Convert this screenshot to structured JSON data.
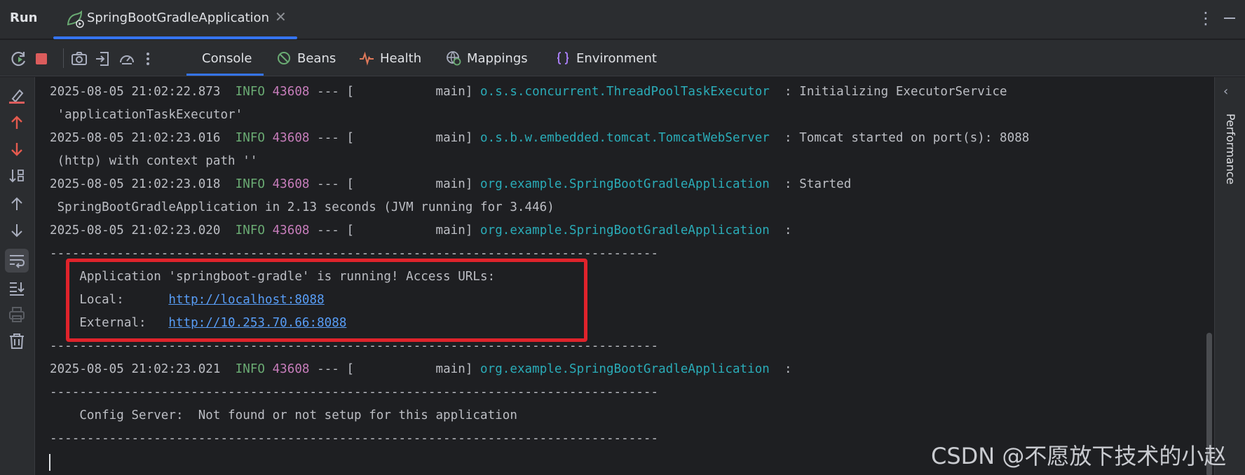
{
  "header": {
    "title": "Run",
    "run_tab_label": "SpringBootGradleApplication"
  },
  "toolbar": {
    "tabs": [
      {
        "label": "Console",
        "icon": "console",
        "active": true
      },
      {
        "label": "Beans",
        "icon": "beans-icon"
      },
      {
        "label": "Health",
        "icon": "health-icon"
      },
      {
        "label": "Mappings",
        "icon": "mappings-icon"
      },
      {
        "label": "Environment",
        "icon": "environment-icon"
      }
    ]
  },
  "console": {
    "lines": [
      {
        "ts": "2025-08-05 21:02:22.873",
        "level": "INFO",
        "pid": "43608",
        "sep": "--- [",
        "thread": "           main]",
        "logger": "o.s.s.concurrent.ThreadPoolTaskExecutor",
        "msg": "  : Initializing ExecutorService"
      },
      {
        "text": " 'applicationTaskExecutor'"
      },
      {
        "ts": "2025-08-05 21:02:23.016",
        "level": "INFO",
        "pid": "43608",
        "sep": "--- [",
        "thread": "           main]",
        "logger": "o.s.b.w.embedded.tomcat.TomcatWebServer",
        "msg": "  : Tomcat started on port(s): 8088"
      },
      {
        "text": " (http) with context path ''"
      },
      {
        "ts": "2025-08-05 21:02:23.018",
        "level": "INFO",
        "pid": "43608",
        "sep": "--- [",
        "thread": "           main]",
        "logger": "org.example.SpringBootGradleApplication",
        "msg": "  : Started"
      },
      {
        "text": " SpringBootGradleApplication in 2.13 seconds (JVM running for 3.446)"
      },
      {
        "ts": "2025-08-05 21:02:23.020",
        "level": "INFO",
        "pid": "43608",
        "sep": "--- [",
        "thread": "           main]",
        "logger": "org.example.SpringBootGradleApplication",
        "msg": "  :"
      },
      {
        "text": "----------------------------------------------------------------------------------"
      },
      {
        "text": "    Application 'springboot-gradle' is running! Access URLs:"
      },
      {
        "prefix": "    Local:      ",
        "url": "http://localhost:8088"
      },
      {
        "prefix": "    External:   ",
        "url": "http://10.253.70.66:8088"
      },
      {
        "text": "----------------------------------------------------------------------------------"
      },
      {
        "ts": "2025-08-05 21:02:23.021",
        "level": "INFO",
        "pid": "43608",
        "sep": "--- [",
        "thread": "           main]",
        "logger": "org.example.SpringBootGradleApplication",
        "msg": "  :"
      },
      {
        "text": "----------------------------------------------------------------------------------"
      },
      {
        "text": "    Config Server:  Not found or not setup for this application"
      },
      {
        "text": "----------------------------------------------------------------------------------"
      }
    ]
  },
  "right_panel": {
    "label": "Performance"
  },
  "watermark": "CSDN @不愿放下技术的小赵",
  "colors": {
    "accent": "#3574f0",
    "info": "#6aab73",
    "pid": "#c77dbb",
    "logger": "#2aacb8",
    "highlight": "#e0232b",
    "link": "#589df6"
  }
}
